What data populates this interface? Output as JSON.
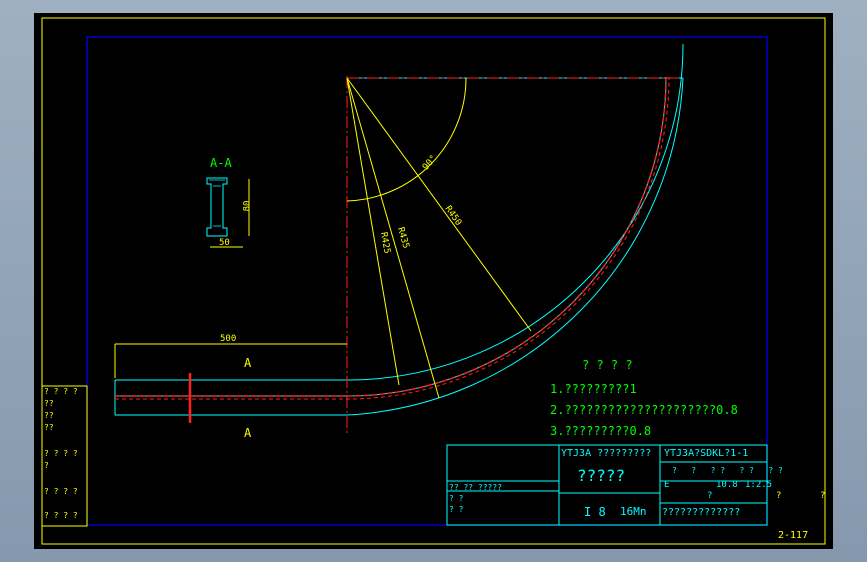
{
  "section_label": "A-A",
  "section_dims": {
    "height": "80",
    "width": "50"
  },
  "straight_length": "500",
  "cut_marks": {
    "top": "A",
    "bottom": "A"
  },
  "radii": {
    "inner": "R425",
    "mid": "R435",
    "outer": "R450"
  },
  "angle": "90°",
  "notes": {
    "heading": "? ? ? ?",
    "items": [
      "1.?????????1",
      "2.?????????????????????0.8",
      "3.?????????0.8"
    ]
  },
  "left_table": {
    "rows": [
      {
        "a": "? ?",
        "b": "? ?"
      },
      {
        "a": "??",
        "b": ""
      },
      {
        "a": "??",
        "b": ""
      },
      {
        "a": "??",
        "b": ""
      },
      {
        "a": "? ? ? ? ?",
        "b": ""
      },
      {
        "a": "? ? ? ?",
        "b": ""
      },
      {
        "a": "? ?",
        "b": "? ?"
      }
    ]
  },
  "title_block": {
    "company": "YTJ3A ?????????",
    "drawing_no": "YTJ3A?SDKL?1-1",
    "part_name": "?????",
    "spec": "I 8",
    "material": "16Mn",
    "mass": "10.8",
    "scale": "1:2.5",
    "mark": "E",
    "header_cells": [
      "?",
      "?",
      "? ?",
      "? ?",
      "? ?"
    ],
    "left_cells": [
      "?? ??",
      "?????",
      "? ?",
      "? ?"
    ],
    "bottom_label": "?????????????",
    "sheet_q": "?",
    "outer_q1": "?",
    "outer_q2": "?"
  },
  "sheet_number": "2-117",
  "colors": {
    "frame": "#ffff00",
    "border": "#0000ff",
    "cyan": "#00ffff",
    "red": "#ff2020",
    "green": "#00ff00",
    "white": "#ffffff",
    "magenta": "#ff00ff"
  }
}
